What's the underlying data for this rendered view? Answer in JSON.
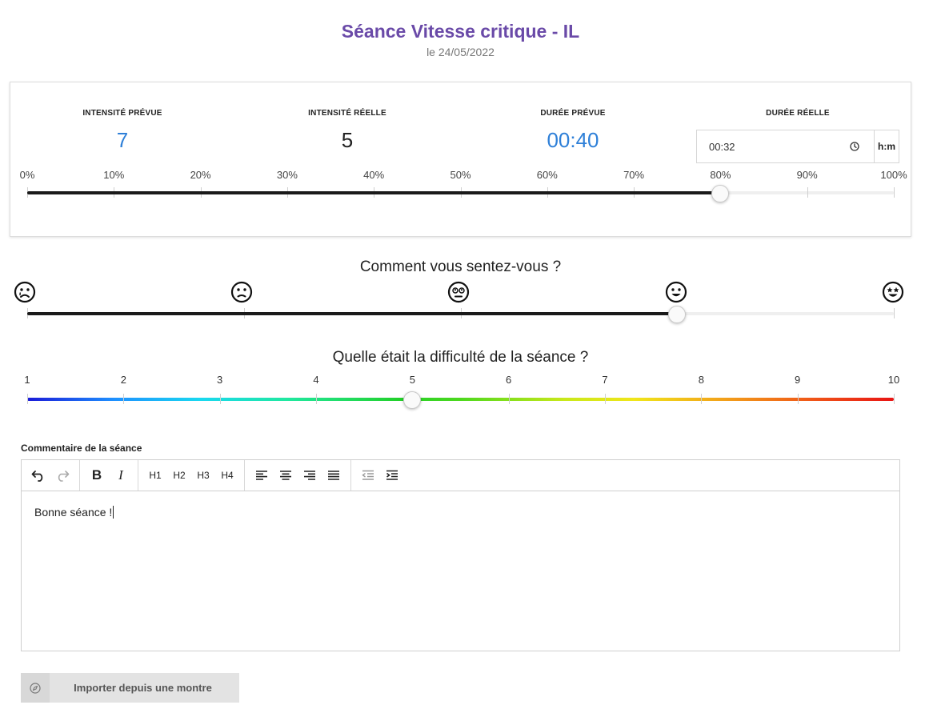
{
  "header": {
    "title": "Séance Vitesse critique - IL",
    "date": "le 24/05/2022"
  },
  "metrics": {
    "planned_intensity_label": "INTENSITÉ PRÉVUE",
    "planned_intensity_value": "7",
    "actual_intensity_label": "INTENSITÉ RÉELLE",
    "actual_intensity_value": "5",
    "planned_duration_label": "DURÉE PRÉVUE",
    "planned_duration_value": "00:40",
    "actual_duration_label": "DURÉE RÉELLE",
    "actual_duration_value": "00:32",
    "actual_duration_unit": "h:m"
  },
  "progress_slider": {
    "labels": [
      "0%",
      "10%",
      "20%",
      "30%",
      "40%",
      "50%",
      "60%",
      "70%",
      "80%",
      "90%",
      "100%"
    ],
    "value_percent": 80
  },
  "feeling": {
    "question": "Comment vous sentez-vous ?",
    "faces": [
      "sad-face-icon",
      "frown-face-icon",
      "neutral-face-icon",
      "smile-face-icon",
      "star-eyes-face-icon"
    ],
    "selected_index": 3
  },
  "difficulty": {
    "question": "Quelle était la difficulté de la séance ?",
    "labels": [
      "1",
      "2",
      "3",
      "4",
      "5",
      "6",
      "7",
      "8",
      "9",
      "10"
    ],
    "value": 5
  },
  "comment": {
    "label": "Commentaire de la séance",
    "text": "Bonne séance !",
    "toolbar": {
      "h1": "H1",
      "h2": "H2",
      "h3": "H3",
      "h4": "H4"
    }
  },
  "import_button": {
    "label": "Importer depuis une montre",
    "icon": "compass-icon"
  },
  "colors": {
    "title": "#6a4aa8",
    "accent_blue": "#2f80d8",
    "slider_dark": "#1a1a1a"
  }
}
